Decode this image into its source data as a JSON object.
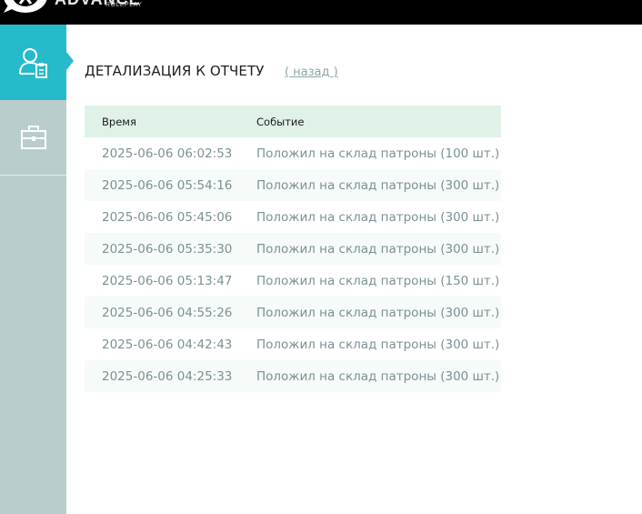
{
  "header": {
    "logo_text": "ADVANCE",
    "logo_subtext": "ROLEPLAY"
  },
  "sidebar": {
    "items": [
      {
        "name": "profile",
        "icon": "user-clipboard-icon",
        "active": true
      },
      {
        "name": "briefcase",
        "icon": "briefcase-icon",
        "active": false
      }
    ],
    "colors": {
      "active": "#27bacb",
      "background": "#b9cdcd"
    }
  },
  "main": {
    "title": "ДЕТАЛИЗАЦИЯ К ОТЧЕТУ",
    "back_link": "( назад )",
    "table": {
      "columns": [
        "Время",
        "Событие"
      ],
      "rows": [
        {
          "time": "2025-06-06 06:02:53",
          "event": "Положил на склад патроны (100 шт.)"
        },
        {
          "time": "2025-06-06 05:54:16",
          "event": "Положил на склад патроны (300 шт.)"
        },
        {
          "time": "2025-06-06 05:45:06",
          "event": "Положил на склад патроны (300 шт.)"
        },
        {
          "time": "2025-06-06 05:35:30",
          "event": "Положил на склад патроны (300 шт.)"
        },
        {
          "time": "2025-06-06 05:13:47",
          "event": "Положил на склад патроны (150 шт.)"
        },
        {
          "time": "2025-06-06 04:55:26",
          "event": "Положил на склад патроны (300 шт.)"
        },
        {
          "time": "2025-06-06 04:42:43",
          "event": "Положил на склад патроны (300 шт.)"
        },
        {
          "time": "2025-06-06 04:25:33",
          "event": "Положил на склад патроны (300 шт.)"
        }
      ]
    }
  }
}
